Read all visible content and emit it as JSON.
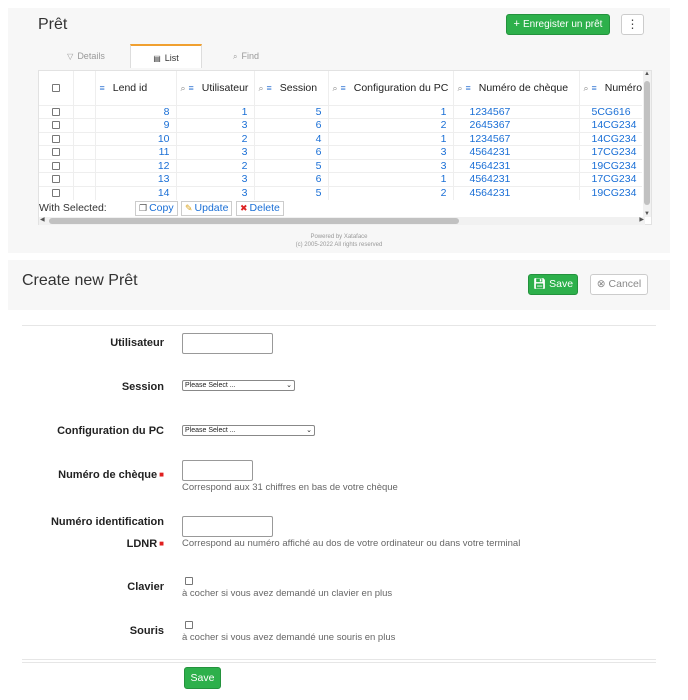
{
  "list_panel": {
    "title": "Prêt",
    "add_button_label": "Enregister un prêt",
    "more_icon": "kebab-icon",
    "tabs": [
      {
        "label": "Details",
        "icon": "filter-icon",
        "active": false
      },
      {
        "label": "List",
        "icon": "list-icon",
        "active": true
      },
      {
        "label": "Find",
        "icon": "search-icon",
        "active": false
      }
    ],
    "columns": [
      "Lend id",
      "Utilisateur",
      "Session",
      "Configuration du PC",
      "Numéro de chèque",
      "Numéro"
    ],
    "rows": [
      [
        "8",
        "1",
        "5",
        "1",
        "1234567",
        "5CG616"
      ],
      [
        "9",
        "3",
        "6",
        "2",
        "2645367",
        "14CG234"
      ],
      [
        "10",
        "2",
        "4",
        "1",
        "1234567",
        "14CG234"
      ],
      [
        "11",
        "3",
        "6",
        "3",
        "4564231",
        "17CG234"
      ],
      [
        "12",
        "2",
        "5",
        "3",
        "4564231",
        "19CG234"
      ],
      [
        "13",
        "3",
        "6",
        "1",
        "4564231",
        "17CG234"
      ],
      [
        "14",
        "3",
        "5",
        "2",
        "4564231",
        "19CG234"
      ]
    ],
    "with_selected_label": "With Selected:",
    "actions": {
      "copy": "Copy",
      "update": "Update",
      "delete": "Delete"
    },
    "powered_line1": "Powered by Xataface",
    "powered_line2": "(c) 2005-2022 All rights reserved"
  },
  "create_form": {
    "title": "Create new Prêt",
    "save_label": "Save",
    "cancel_label": "Cancel",
    "fields": {
      "utilisateur": {
        "label": "Utilisateur",
        "value": ""
      },
      "session": {
        "label": "Session",
        "selected": "Please Select ..."
      },
      "config_pc": {
        "label": "Configuration du PC",
        "selected": "Please Select ..."
      },
      "numero_cheque": {
        "label": "Numéro de chèque",
        "help": "Correspond aux 31 chiffres en bas de votre chèque",
        "required": true
      },
      "numero_ldnr": {
        "label_line1": "Numéro identification",
        "label_line2": "LDNR",
        "help": "Correspond au numéro affiché au dos de votre ordinateur ou dans votre terminal",
        "required": true
      },
      "clavier": {
        "label": "Clavier",
        "help": "à cocher si vous avez demandé un clavier en plus",
        "checked": false
      },
      "souris": {
        "label": "Souris",
        "help": "à cocher si vous avez demandé une souris en plus",
        "checked": false
      }
    },
    "bottom_save_label": "Save"
  },
  "colors": {
    "accent_green": "#2db04b",
    "link_blue": "#1a6fd6",
    "required_red": "#e02020",
    "tab_active_border": "#f0a030"
  }
}
